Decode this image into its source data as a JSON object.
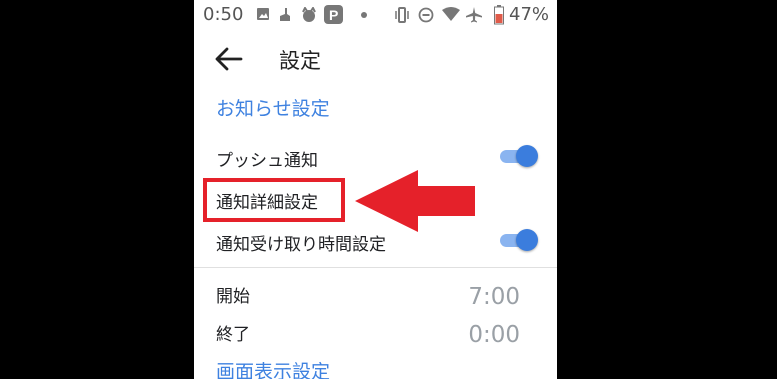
{
  "status_bar": {
    "time": "0:50",
    "battery": "47%",
    "icons": [
      "image-icon",
      "broom-icon",
      "cat-icon",
      "paypay-icon",
      "dot-icon",
      "vibrate-icon",
      "dnd-icon",
      "wifi-icon",
      "airplane-icon",
      "battery-icon"
    ]
  },
  "header": {
    "title": "設定",
    "back_icon": "arrow-left-icon"
  },
  "sections": {
    "notification": "お知らせ設定",
    "display": "画面表示設定"
  },
  "rows": {
    "push": {
      "label": "プッシュ通知",
      "toggle_on": true
    },
    "detail": {
      "label": "通知詳細設定"
    },
    "time_setting": {
      "label": "通知受け取り時間設定",
      "toggle_on": true
    },
    "start": {
      "label": "開始",
      "value": "7:00"
    },
    "end": {
      "label": "終了",
      "value": "0:00"
    }
  },
  "colors": {
    "accent": "#3f82e0",
    "toggle_thumb": "#3b7ddd",
    "toggle_track": "#8ab4f0",
    "annotation_red": "#e5212a"
  }
}
